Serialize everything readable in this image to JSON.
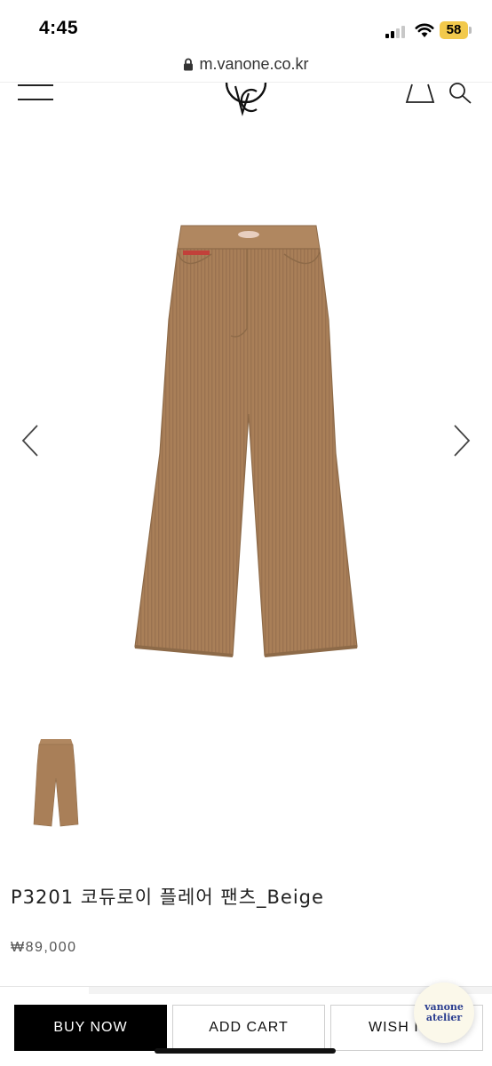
{
  "status_bar": {
    "time": "4:45",
    "battery": "58"
  },
  "browser": {
    "url": "m.vanone.co.kr"
  },
  "product": {
    "title": "P3201 코듀로이 플레어 팬츠_Beige",
    "price": "₩89,000",
    "color": "#a97f58"
  },
  "actions": {
    "buy_label": "BUY NOW",
    "cart_label": "ADD CART",
    "wish_label": "WISH IT"
  },
  "badge": {
    "line1": "vanone",
    "line2": "atelier"
  },
  "icons": {
    "menu": "hamburger-menu-icon",
    "logo": "vc-logo",
    "bag": "shopping-bag-icon",
    "search": "search-icon",
    "prev": "chevron-left-icon",
    "next": "chevron-right-icon"
  }
}
